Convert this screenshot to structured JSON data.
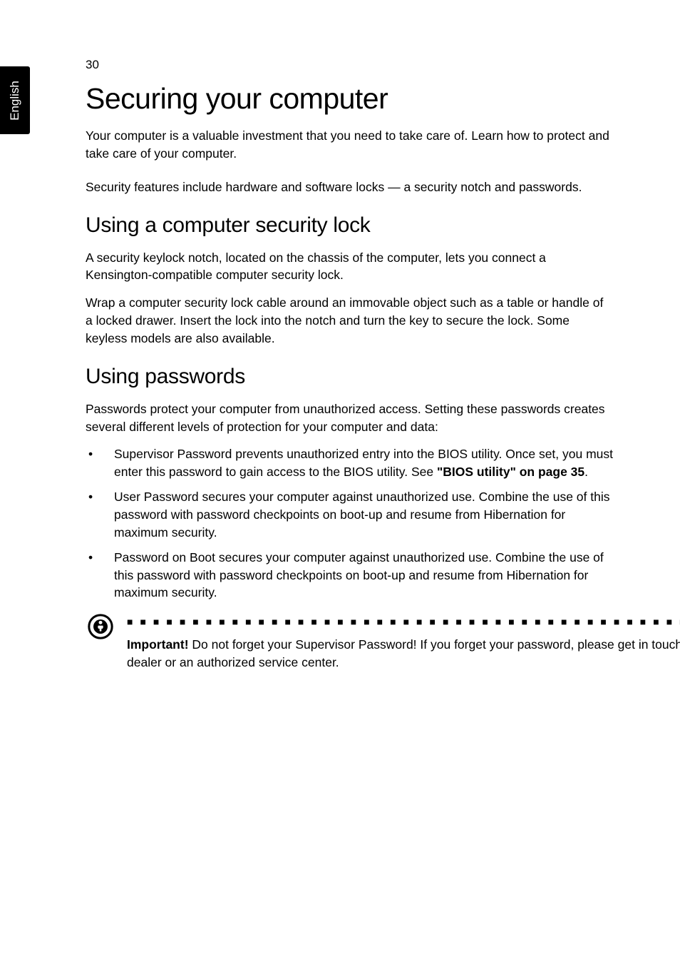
{
  "page_number": "30",
  "side_tab": "English",
  "h1": "Securing your computer",
  "intro1": "Your computer is a valuable investment that you need to take care of. Learn how to protect and take care of your computer.",
  "intro2": "Security features include hardware and software locks — a security notch and passwords.",
  "h2a": "Using a computer security lock",
  "sec_p1": "A security keylock notch, located on the chassis of the computer, lets you connect a Kensington-compatible computer security lock.",
  "sec_p2": "Wrap a computer security lock cable around an immovable object such as a table or handle of a locked drawer. Insert the lock into the notch and turn the key to secure the lock. Some keyless models are also available.",
  "h2b": "Using passwords",
  "pw_intro": "Passwords protect your computer from unauthorized access. Setting these passwords creates several different levels of protection for your computer and data:",
  "li1_a": "Supervisor Password prevents unauthorized entry into the BIOS utility. Once set, you must enter this password to gain access to the BIOS utility. See ",
  "li1_b": "\"BIOS utility\" on page 35",
  "li1_c": ".",
  "li2": "User Password secures your computer against unauthorized use. Combine the use of this password with password checkpoints on boot-up and resume from Hibernation for maximum security.",
  "li3": "Password on Boot secures your computer against unauthorized use. Combine the use of this password with password checkpoints on boot-up and resume from Hibernation for maximum security.",
  "note_label": "Important!",
  "note_body": " Do not forget your Supervisor Password! If you forget your password, please get in touch with your dealer or an authorized service center."
}
